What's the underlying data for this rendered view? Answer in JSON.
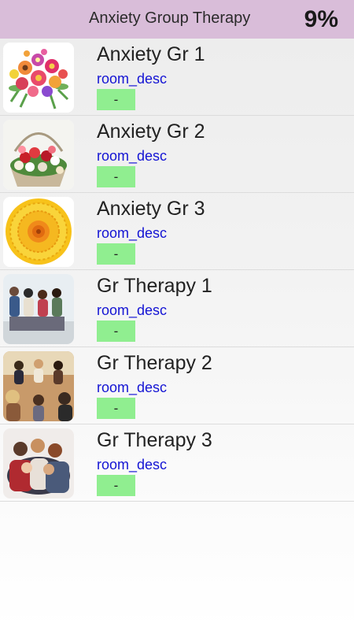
{
  "header": {
    "title": "Anxiety Group Therapy",
    "percent": "9%"
  },
  "rooms": [
    {
      "name": "Anxiety Gr 1",
      "desc": "room_desc",
      "button": "-",
      "image": "flower-bouquet-icon"
    },
    {
      "name": "Anxiety Gr 2",
      "desc": "room_desc",
      "button": "-",
      "image": "flower-basket-icon"
    },
    {
      "name": "Anxiety Gr 3",
      "desc": "room_desc",
      "button": "-",
      "image": "sunflower-icon"
    },
    {
      "name": "Gr Therapy 1",
      "desc": "room_desc",
      "button": "-",
      "image": "group-photo-icon"
    },
    {
      "name": "Gr Therapy 2",
      "desc": "room_desc",
      "button": "-",
      "image": "group-circle-photo-icon"
    },
    {
      "name": "Gr Therapy 3",
      "desc": "room_desc",
      "button": "-",
      "image": "group-hug-photo-icon"
    }
  ],
  "colors": {
    "header_bg": "#d9bdd9",
    "desc_text": "#1414d4",
    "button_bg": "#90ee90"
  }
}
